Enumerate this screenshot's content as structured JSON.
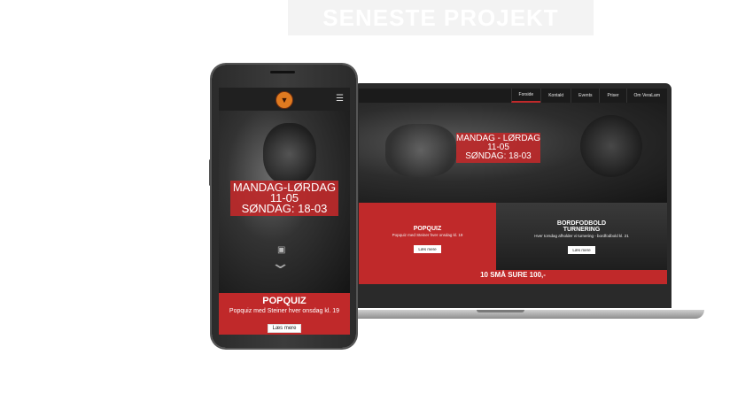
{
  "heading": "SENESTE PROJEKT",
  "colors": {
    "accent_red": "#c0292a",
    "dark": "#1b1b1b",
    "logo_orange": "#e07a20"
  },
  "laptop": {
    "nav": [
      "Forside",
      "Kontakt",
      "Events",
      "Priser",
      "Om VeraLam"
    ],
    "nav_active": "Forside",
    "hero": {
      "line1": "MANDAG - LØRDAG",
      "line2": "11-05",
      "line3": "SØNDAG: 18-03"
    },
    "card_left": {
      "title": "POPQUIZ",
      "text": "Popquiz med Steiner hver onsdag kl. 19",
      "button": "Læs mere"
    },
    "card_right": {
      "title_line1": "BORDFODBOLD",
      "title_line2": "TURNERING",
      "text": "Hver torsdag afholder vi turnering - bordfodbold kl. 21",
      "button": "Læs mere"
    },
    "strip": "10 SMÅ SURE 100,-"
  },
  "phone": {
    "menu_icon": "hamburger-icon",
    "logo_icon": "bar-logo-icon",
    "hero": {
      "line1": "MANDAG-LØRDAG",
      "line2": "11-05",
      "line3": "SØNDAG: 18-03"
    },
    "card": {
      "title": "POPQUIZ",
      "text": "Popquiz med Steiner hver onsdag kl. 19",
      "button": "Læs mere"
    }
  }
}
